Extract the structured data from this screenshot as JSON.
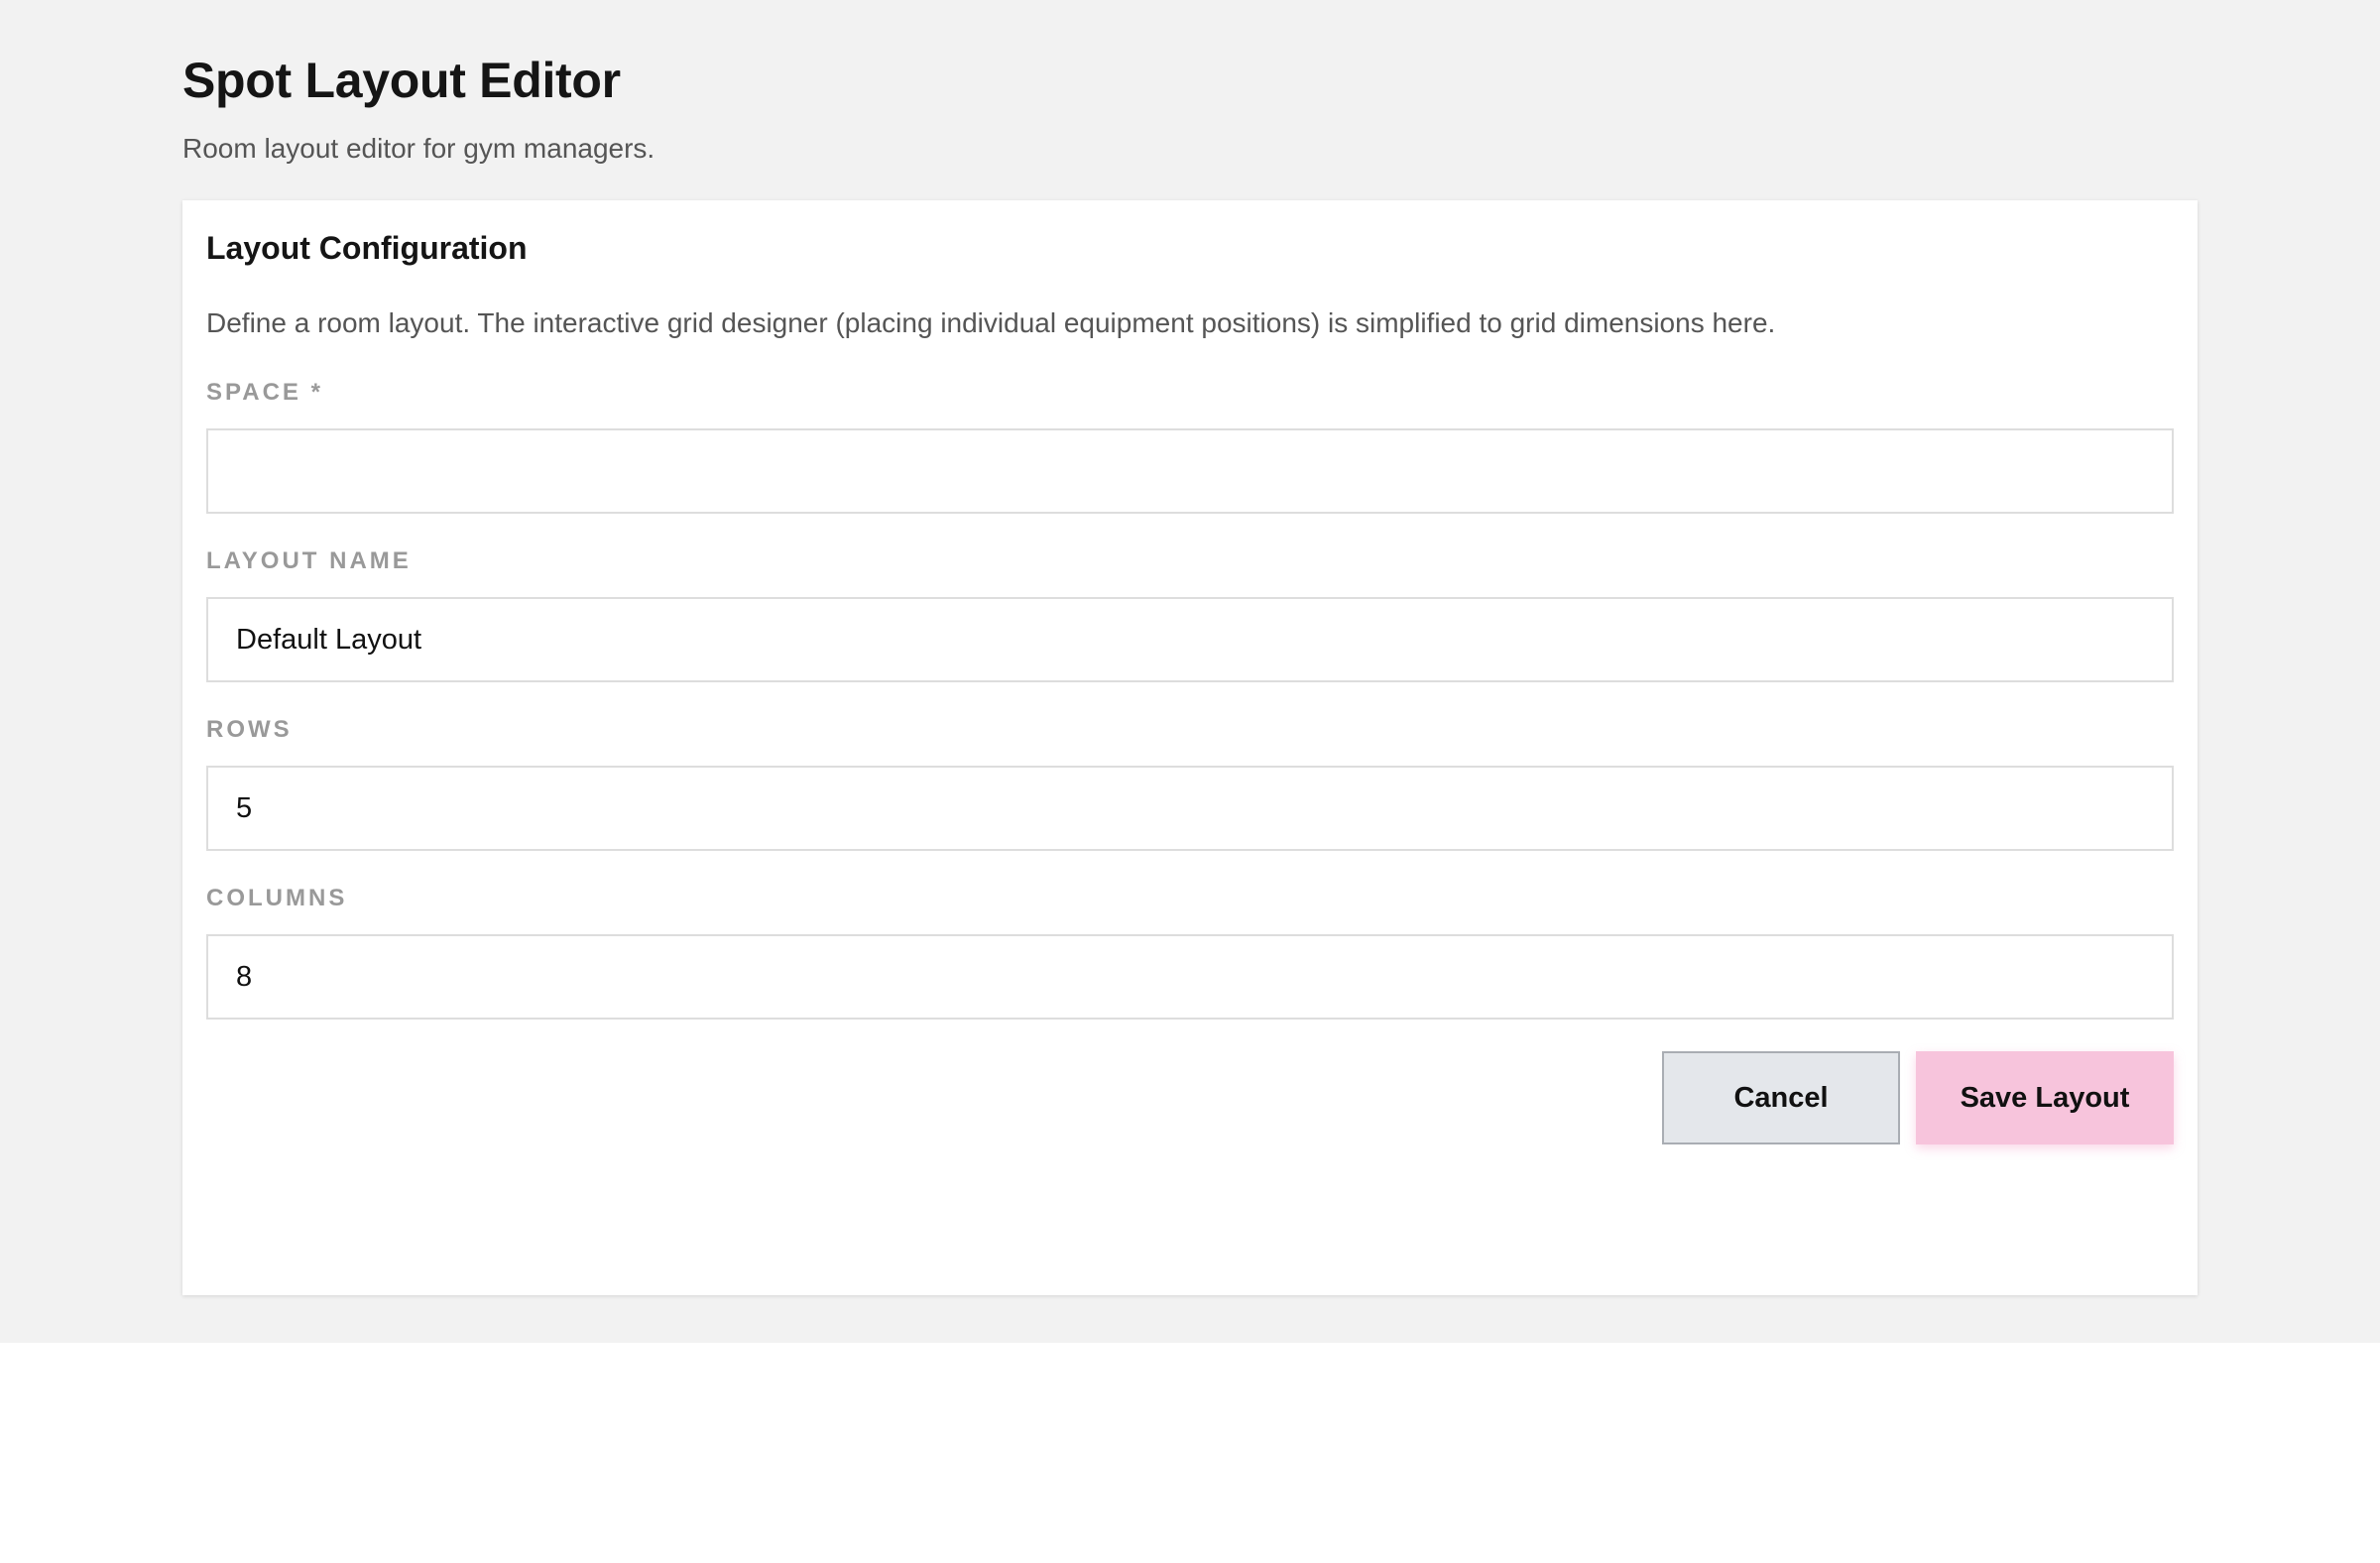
{
  "page": {
    "title": "Spot Layout Editor",
    "subtitle": "Room layout editor for gym managers."
  },
  "card": {
    "title": "Layout Configuration",
    "description": "Define a room layout. The interactive grid designer (placing individual equipment positions) is simplified to grid dimensions here."
  },
  "fields": {
    "space": {
      "label": "SPACE *",
      "value": ""
    },
    "layout_name": {
      "label": "LAYOUT NAME",
      "value": "Default Layout"
    },
    "rows": {
      "label": "ROWS",
      "value": "5"
    },
    "columns": {
      "label": "COLUMNS",
      "value": "8"
    }
  },
  "actions": {
    "cancel_label": "Cancel",
    "save_label": "Save Layout"
  },
  "colors": {
    "background": "#f2f2f2",
    "card": "#ffffff",
    "cancel_button": "#e4e7eb",
    "save_button": "#f7c4dc"
  }
}
